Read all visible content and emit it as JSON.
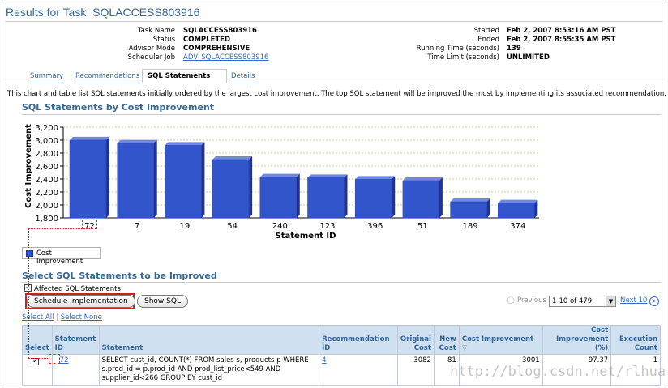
{
  "header": {
    "title": "Results for Task: SQLACCESS803916"
  },
  "task_info": {
    "left": [
      {
        "label": "Task Name",
        "value": "SQLACCESS803916"
      },
      {
        "label": "Status",
        "value": "COMPLETED"
      },
      {
        "label": "Advisor Mode",
        "value": "COMPREHENSIVE"
      },
      {
        "label": "Scheduler Job",
        "value": "ADV_SQLACCESS803916"
      }
    ],
    "right": [
      {
        "label": "Started",
        "value": "Feb 2, 2007 8:53:16 AM PST"
      },
      {
        "label": "Ended",
        "value": "Feb 2, 2007 8:55:35 AM PST"
      },
      {
        "label": "Running Time (seconds)",
        "value": "139"
      },
      {
        "label": "Time Limit (seconds)",
        "value": "UNLIMITED"
      }
    ]
  },
  "tabs": [
    {
      "label": "Summary",
      "active": false
    },
    {
      "label": "Recommendations",
      "active": false
    },
    {
      "label": "SQL Statements",
      "active": true
    },
    {
      "label": "Details",
      "active": false
    }
  ],
  "intro_text": "This chart and table list SQL statements initially ordered by the largest cost improvement. The top SQL statement will be improved the most by implementing its associated recommendation.",
  "chart_section_title": "SQL Statements by Cost Improvement",
  "chart_data": {
    "type": "bar",
    "categories": [
      "72",
      "7",
      "19",
      "54",
      "240",
      "123",
      "396",
      "51",
      "189",
      "374"
    ],
    "series": [
      {
        "name": "Cost Improvement",
        "values": [
          3001,
          2955,
          2920,
          2700,
          2430,
          2420,
          2395,
          2375,
          2050,
          2030
        ]
      }
    ],
    "xlabel": "Statement ID",
    "ylabel": "Cost Improvement",
    "ylim": [
      1800,
      3200
    ],
    "yticks": [
      "1,800",
      "2,000",
      "2,200",
      "2,400",
      "2,600",
      "2,800",
      "3,000",
      "3,200"
    ],
    "grid": true,
    "legend": "bottom-left",
    "color": "#3355cc"
  },
  "legend_label": "Cost Improvement",
  "select_section_title": "Select SQL Statements to be Improved",
  "affected_label": "Affected SQL Statements",
  "buttons": {
    "schedule": "Schedule Implementation",
    "show_sql": "Show SQL"
  },
  "pager": {
    "previous": "Previous",
    "range": "1-10 of 479",
    "next": "Next 10"
  },
  "select_links": {
    "all": "Select All",
    "none": "Select None"
  },
  "table": {
    "headers": [
      "Select",
      "Statement ID",
      "Statement",
      "Recommendation ID",
      "Original Cost",
      "New Cost",
      "Cost Improvement",
      "Cost Improvement (%)",
      "Execution Count"
    ],
    "rows": [
      {
        "statement_id": "72",
        "statement": "SELECT cust_id, COUNT(*) FROM sales s, products p WHERE s.prod_id = p.prod_id AND prod_list_price<549 AND supplier_id<266 GROUP BY cust_id",
        "recommendation_id": "4",
        "original_cost": "3082",
        "new_cost": "81",
        "cost_improvement": "3001",
        "cost_improvement_pct": "97.37",
        "execution_count": "1"
      }
    ]
  },
  "watermark": "http://blog.csdn.net/rlhua",
  "colors": {
    "link": "#3366cc",
    "heading": "#336699",
    "bar": "#3355cc",
    "highlight": "#cc2222",
    "table_header": "#cfe0f1"
  }
}
